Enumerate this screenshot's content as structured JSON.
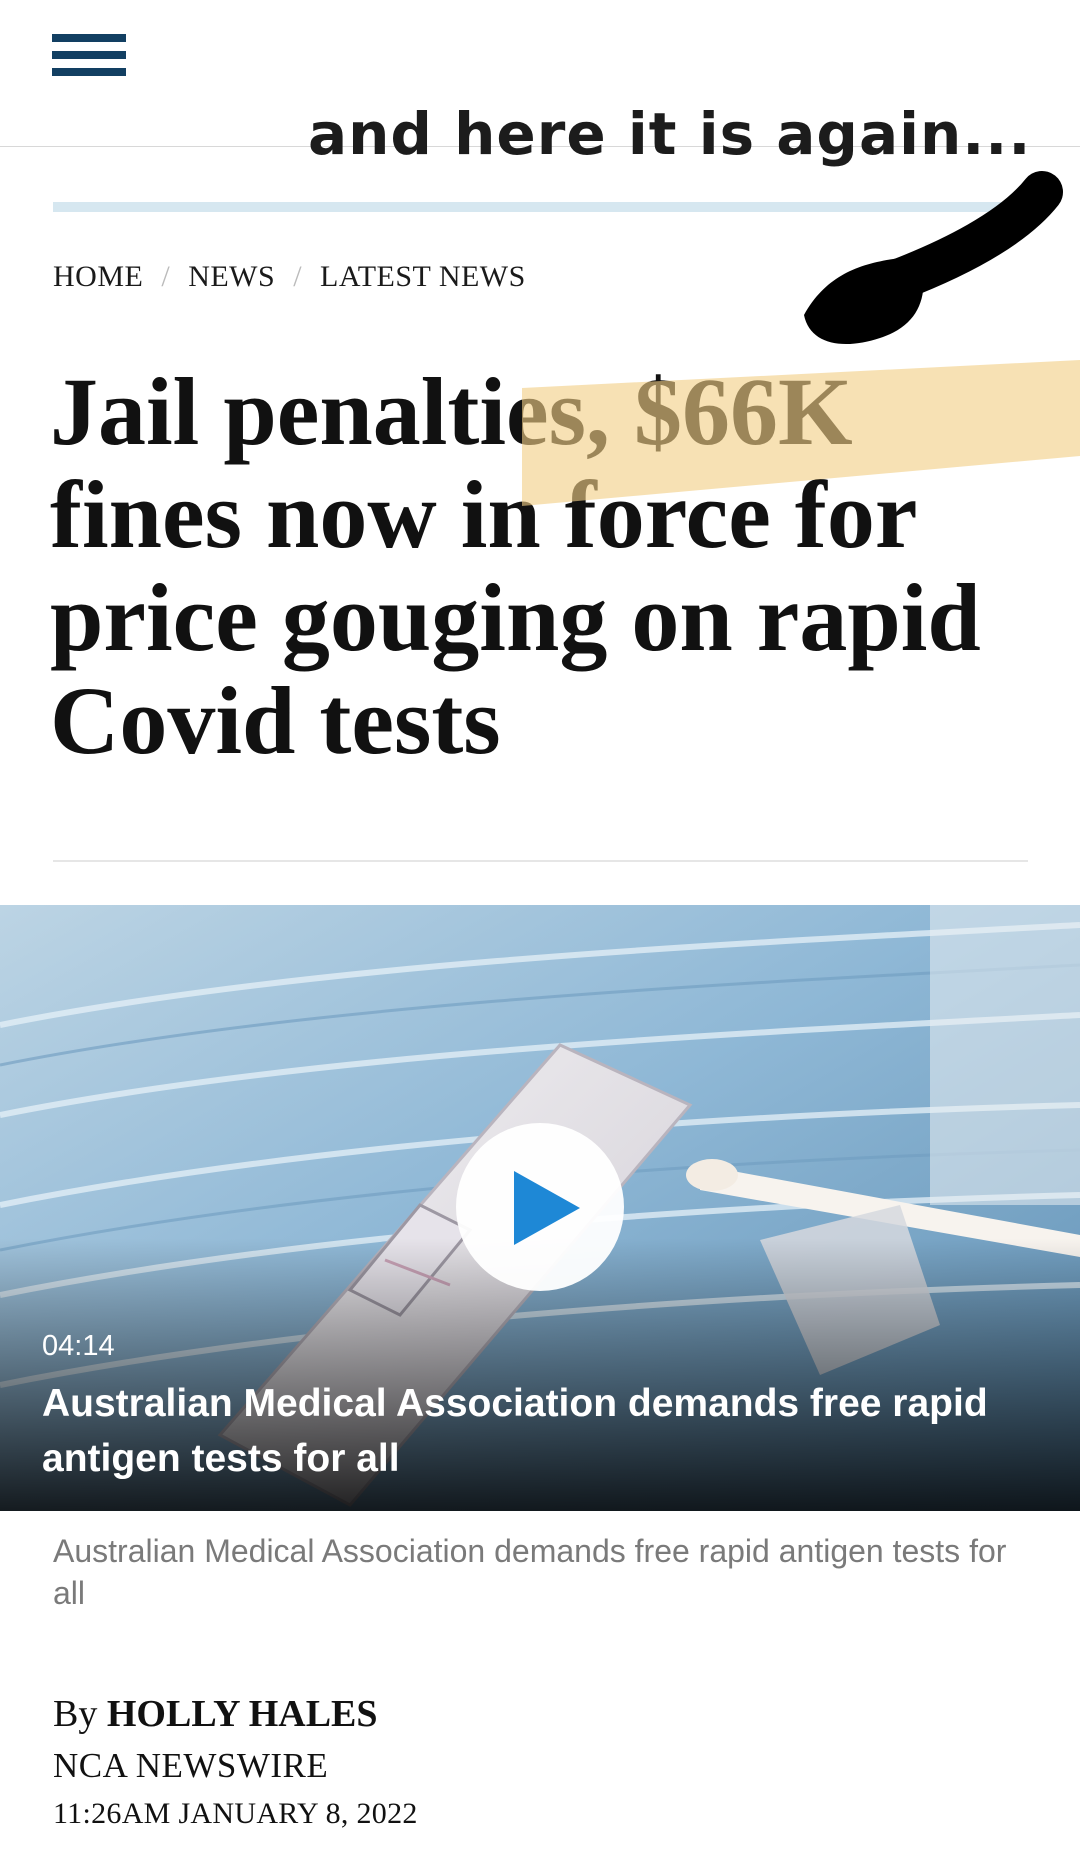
{
  "header": {
    "menu_icon": "hamburger-menu-icon",
    "brand_color": "#123f62"
  },
  "annotation": {
    "text": "and here it is again...",
    "arrow": "arrow-icon",
    "highlight_color": "#f2cf86"
  },
  "breadcrumb": {
    "items": [
      "HOME",
      "NEWS",
      "LATEST NEWS"
    ],
    "separator": "/"
  },
  "article": {
    "headline": "Jail penalties, $66K fines now in force for price gouging on rapid Covid tests",
    "video": {
      "duration": "04:14",
      "title": "Australian Medical Association demands free rapid antigen tests for all",
      "play_icon": "play-icon"
    },
    "caption": "Australian Medical Association demands free rapid antigen tests for all",
    "byline_prefix": "By",
    "author": "HOLLY HALES",
    "source": "NCA NEWSWIRE",
    "timestamp": "11:26AM JANUARY 8, 2022"
  }
}
